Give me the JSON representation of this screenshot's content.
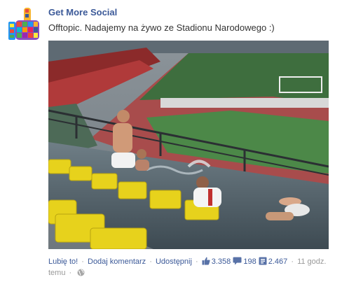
{
  "post": {
    "page_name": "Get More Social",
    "text": "Offtopic. Nadajemy na żywo ze Stadionu Narodowego :)",
    "avatar_icon": "thumbs-up-icon"
  },
  "footer": {
    "like_label": "Lubię to!",
    "comment_label": "Dodaj komentarz",
    "share_label": "Udostępnij",
    "likes_count": "3.358",
    "comments_count": "198",
    "shares_count": "2.467",
    "time_label": "11 godz. temu",
    "separator": "·",
    "privacy_icon": "globe-icon",
    "link_color": "#3b5998"
  }
}
